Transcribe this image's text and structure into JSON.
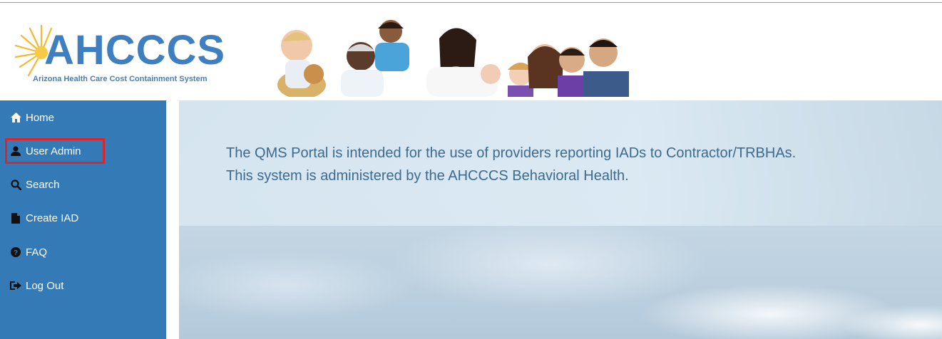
{
  "header": {
    "logo_wordmark": "AHCCCS",
    "logo_subtitle": "Arizona Health Care Cost Containment System",
    "banner_icon": "family-photo-banner"
  },
  "sidebar": {
    "items": [
      {
        "label": "Home",
        "icon": "home-icon"
      },
      {
        "label": "User Admin",
        "icon": "user-icon"
      },
      {
        "label": "Search",
        "icon": "search-icon"
      },
      {
        "label": "Create IAD",
        "icon": "file-icon"
      },
      {
        "label": "FAQ",
        "icon": "question-circle-icon"
      },
      {
        "label": "Log Out",
        "icon": "log-out-icon"
      }
    ]
  },
  "main": {
    "message_line1": "The QMS Portal is intended for the use of providers reporting IADs to Contractor/TRBHAs.",
    "message_line2": "This system is administered by the AHCCCS Behavioral Health."
  },
  "colors": {
    "sidebar_bg": "#337ab7",
    "highlight": "#d9262b",
    "message_text": "#3d6a8f",
    "logo_blue": "#3f7fc0",
    "sun_yellow": "#f5b82e"
  }
}
